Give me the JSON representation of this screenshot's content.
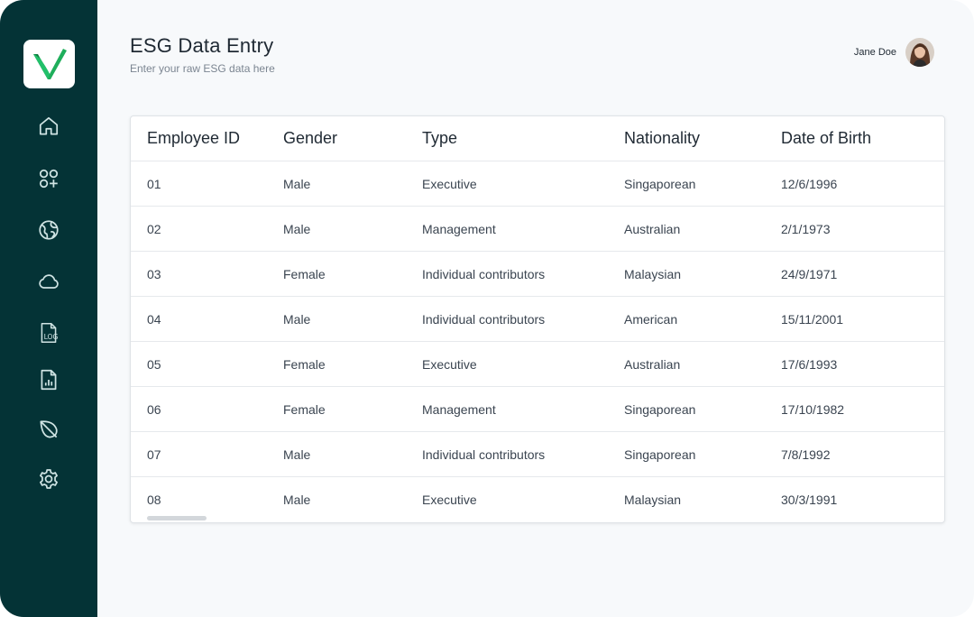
{
  "app": {
    "brand_colors": {
      "sidebar": "#043336",
      "logo_green": "#1fae5b",
      "logo_dark_green": "#0f7a3f"
    }
  },
  "sidebar": {
    "items": [
      {
        "name": "home",
        "icon": "home-icon"
      },
      {
        "name": "apps",
        "icon": "apps-add-icon"
      },
      {
        "name": "globe",
        "icon": "globe-icon"
      },
      {
        "name": "cloud",
        "icon": "cloud-icon"
      },
      {
        "name": "log",
        "icon": "log-file-icon",
        "label": "LOG"
      },
      {
        "name": "report",
        "icon": "report-file-icon"
      },
      {
        "name": "leaf",
        "icon": "leaf-icon"
      },
      {
        "name": "settings",
        "icon": "gear-icon"
      }
    ]
  },
  "header": {
    "title": "ESG Data Entry",
    "subtitle": "Enter your raw ESG data here",
    "user_name": "Jane Doe"
  },
  "table": {
    "columns": [
      "Employee ID",
      "Gender",
      "Type",
      "Nationality",
      "Date of Birth"
    ],
    "rows": [
      [
        "01",
        "Male",
        "Executive",
        "Singaporean",
        "12/6/1996"
      ],
      [
        "02",
        "Male",
        "Management",
        "Australian",
        "2/1/1973"
      ],
      [
        "03",
        "Female",
        "Individual contributors",
        "Malaysian",
        "24/9/1971"
      ],
      [
        "04",
        "Male",
        "Individual contributors",
        "American",
        "15/11/2001"
      ],
      [
        "05",
        "Female",
        "Executive",
        "Australian",
        "17/6/1993"
      ],
      [
        "06",
        "Female",
        "Management",
        "Singaporean",
        "17/10/1982"
      ],
      [
        "07",
        "Male",
        "Individual contributors",
        "Singaporean",
        "7/8/1992"
      ],
      [
        "08",
        "Male",
        "Executive",
        "Malaysian",
        "30/3/1991"
      ]
    ]
  }
}
